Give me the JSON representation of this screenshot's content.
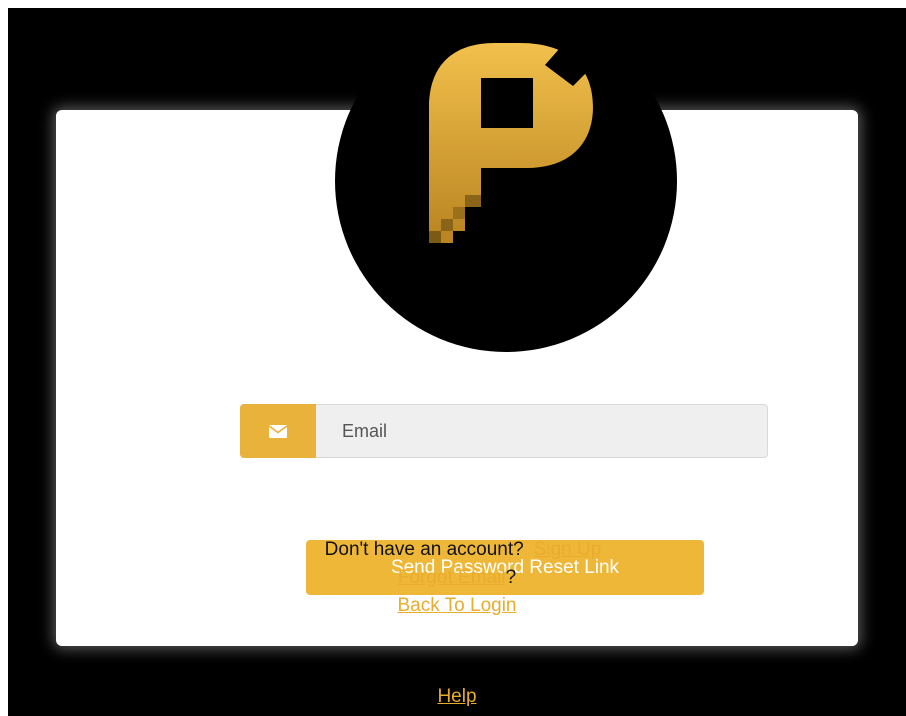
{
  "brand": {
    "logo_icon": "brand-p-logo-icon",
    "accent_color": "#efb738",
    "background_color": "#000000",
    "card_color": "#ffffff"
  },
  "form": {
    "email_icon": "envelope-icon",
    "email_placeholder": "Email",
    "email_value": "",
    "submit_label": "Send Password Reset Link"
  },
  "links": {
    "signup_prompt": "Don't have an account?",
    "signup_label": "Sign Up",
    "forgot_email_label": "Forgot Email",
    "forgot_email_suffix": "?",
    "back_to_login_label": "Back To Login"
  },
  "footer": {
    "help_label": "Help"
  }
}
